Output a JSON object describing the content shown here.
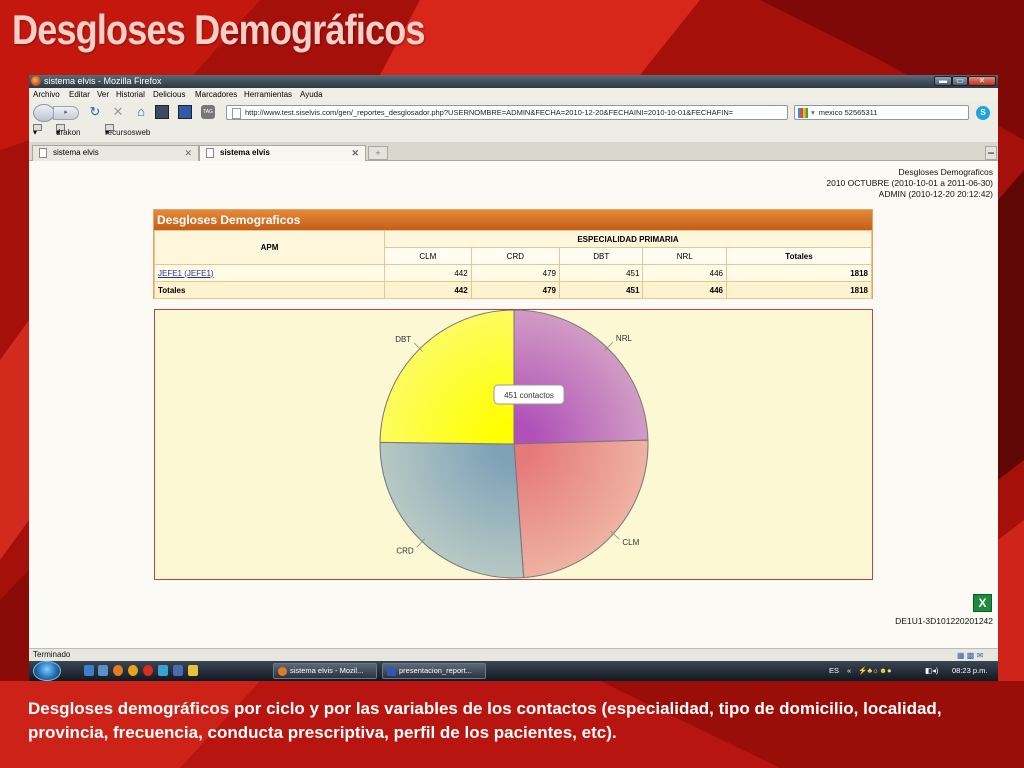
{
  "slide": {
    "title": "Desgloses Demográficos",
    "caption": "Desgloses demográficos por ciclo y por las variables de los contactos (especialidad, tipo de domicilio, localidad, provincia, frecuencia, conducta prescriptiva, perfil de los pacientes, etc)."
  },
  "window": {
    "title": "sistema elvis - Mozilla Firefox",
    "controls": {
      "minimize": "▬",
      "maximize": "▭",
      "close": "✕"
    }
  },
  "menu": [
    "Archivo",
    "Editar",
    "Ver",
    "Historial",
    "Delicious",
    "Marcadores",
    "Herramientas",
    "Ayuda"
  ],
  "nav": {
    "url": "http://www.test.siselvis.com/gen/_reportes_desglosador.php?USERNOMBRE=ADMIN&FECHA=2010-12-20&FECHAINI=2010-10-01&FECHAFIN=",
    "search_value": "mexico 52565311",
    "icons": [
      "back-icon",
      "forward-icon",
      "reload-icon",
      "stop-icon",
      "home-icon",
      "bookmark-icon",
      "sidebar-icon",
      "tag-icon"
    ]
  },
  "bookmarks": [
    "drakon",
    "recursosweb"
  ],
  "tabs": [
    {
      "label": "sistema elvis"
    },
    {
      "label": "sistema elvis"
    }
  ],
  "report": {
    "header_line1": "Desgloses Demograficos",
    "header_line2": "2010 OCTUBRE (2010-10-01 a 2011-06-30)",
    "header_line3": "ADMIN (2010-12-20 20:12:42)",
    "panel_title": "Desgloses Demograficos",
    "col_apm": "APM",
    "col_group": "ESPECIALIDAD PRIMARIA",
    "columns": [
      "CLM",
      "CRD",
      "DBT",
      "NRL",
      "Totales"
    ],
    "rows": [
      {
        "apm": "JEFE1 (JEFE1)",
        "values": [
          "442",
          "479",
          "451",
          "446",
          "1818"
        ]
      }
    ],
    "totals": {
      "label": "Totales",
      "values": [
        "442",
        "479",
        "451",
        "446",
        "1818"
      ]
    },
    "code": "DE1U1-3D101220201242"
  },
  "chart_data": {
    "type": "pie",
    "categories": [
      "NRL",
      "CLM",
      "CRD",
      "DBT"
    ],
    "values": [
      446,
      442,
      479,
      451
    ],
    "colors": [
      "#b050b8",
      "#e57a7a",
      "#7fa2b8",
      "#ffff00"
    ],
    "tooltip": "451 contactos",
    "title": ""
  },
  "status": {
    "text": "Terminado"
  },
  "taskbar": {
    "tasks": [
      "sistema elvis - Mozil...",
      "presentacion_report..."
    ],
    "lang": "ES",
    "time": "08:23 p.m."
  }
}
